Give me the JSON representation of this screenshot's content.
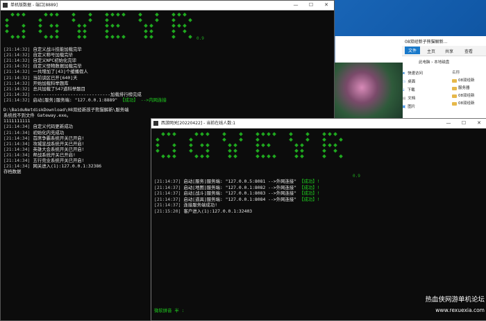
{
  "explorer": {
    "titlebar_text": "08双经新子熊猫解新...",
    "tabs": [
      "文件",
      "主页",
      "共享",
      "查看"
    ],
    "address": "此电脑 › 本地磁盘",
    "nav_items": [
      "快速访问",
      "桌面",
      "下载",
      "文档",
      "图片"
    ],
    "files_header": "名称",
    "files": [
      "08双经新",
      "服务器",
      "08双经新",
      "08双经新"
    ]
  },
  "win1": {
    "title": "单机版数据 - 端口[8889]",
    "version": "0.9",
    "controls": [
      "—",
      "☐",
      "✕"
    ],
    "log_top": [
      {
        "ts": "[21:14:32]",
        "msg": "自定义战斗技能加载完毕"
      },
      {
        "ts": "[21:14:32]",
        "msg": "自定义称号加载完毕"
      },
      {
        "ts": "[21:14:32]",
        "msg": "自定义NPC初始化完毕"
      },
      {
        "ts": "[21:14:32]",
        "msg": "自定义怪物数据加载完毕"
      },
      {
        "ts": "[21:14:32]",
        "msg": "一共增加了[43]个缓播假人"
      },
      {
        "ts": "[21:14:32]",
        "msg": "当前谈区已开[640]天"
      },
      {
        "ts": "[21:14:32]",
        "msg": "开始加载科举题库"
      },
      {
        "ts": "[21:14:32]",
        "msg": "总共加载了547道科举题目"
      },
      {
        "ts": "[21:14:32]",
        "msg": "-----------------------------加载排行榜完成"
      }
    ],
    "service_line": {
      "ts": "[21:14:32]",
      "msg": "启动[服务]服务端: \"127.0.0.1:8889\"",
      "ok": "【成功】",
      "tail": "-->内网连接"
    },
    "path_line": "D:\\BaiduNetdiskDownload\\08双经新孩子熊猫解新\\服务端",
    "path_line2": "系统找不到文件 Gateway.exe。",
    "digits_line": "1111111111",
    "log_bottom": [
      {
        "ts": "[21:14:34]",
        "msg": "自定义代码更新成功"
      },
      {
        "ts": "[21:14:34]",
        "msg": "初始化内充成功"
      },
      {
        "ts": "[21:14:34]",
        "msg": "首席争霸系统开关已开启!"
      },
      {
        "ts": "[21:14:34]",
        "msg": "攻城宣战系统开关已开启!"
      },
      {
        "ts": "[21:14:34]",
        "msg": "英雄大会系统开关已开启!"
      },
      {
        "ts": "[21:14:34]",
        "msg": "帮战系统开关已开启!"
      },
      {
        "ts": "[21:14:34]",
        "msg": "五行竞业系统开关已开启!"
      },
      {
        "ts": "[21:14:34]",
        "msg": "网关进入(1):127.0.0.1:32386"
      }
    ],
    "save_line": "存档数据"
  },
  "win2": {
    "title": "西游网关[20220422] - 当前在线人数:1",
    "version": "0.9",
    "controls": [
      "—",
      "☐",
      "✕"
    ],
    "log": [
      {
        "ts": "[21:14:37]",
        "msg": "启动[服务]服务端: \"127.0.0.5:8081 -->外网连接\"",
        "ok": "【成功】!"
      },
      {
        "ts": "[21:14:37]",
        "msg": "启动[地图]服务端: \"127.0.0.1:8082 -->外网连接\"",
        "ok": "【成功】!"
      },
      {
        "ts": "[21:14:37]",
        "msg": "启动[战斗]服务端: \"127.0.0.1:8083 -->外网连接\"",
        "ok": "【成功】!"
      },
      {
        "ts": "[21:14:37]",
        "msg": "启动[道具]服务端: \"127.0.0.1:8084 -->外网连接\"",
        "ok": "【成功】!"
      },
      {
        "ts": "[21:14:37]",
        "msg": "连接服务端成功!"
      },
      {
        "ts": "[21:15:20]",
        "msg": "客户进入(1):127.0.0.1:32403"
      }
    ],
    "ime_status": "微软拼音 半 :"
  },
  "watermark": {
    "line1": "热血侠网游单机论坛",
    "line2": "www.rexuexia.com"
  },
  "colors": {
    "console_bg": "#0c0c0c",
    "console_text": "#c0c0c0",
    "success_green": "#1fd11f",
    "logo_green": "#1fa81f"
  }
}
